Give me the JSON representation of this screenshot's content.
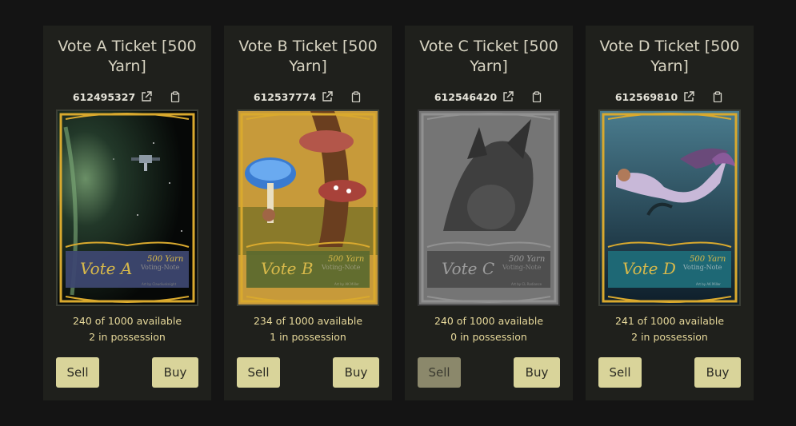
{
  "cards": [
    {
      "title": "Vote A Ticket [500 Yarn]",
      "id": "612495327",
      "availability": "240 of 1000 available",
      "possession": "2 in possession",
      "sell_label": "Sell",
      "buy_label": "Buy",
      "art": {
        "vote_text": "Vote A",
        "badge_text": "500 Yarn",
        "badge_sub": "Voting-Note",
        "panel_color": "#3d4770",
        "greyed": false,
        "credit": "Art by Claudiusknight"
      }
    },
    {
      "title": "Vote B Ticket [500 Yarn]",
      "id": "612537774",
      "availability": "234 of 1000 available",
      "possession": "1 in possession",
      "sell_label": "Sell",
      "buy_label": "Buy",
      "art": {
        "vote_text": "Vote B",
        "badge_text": "500 Yarn",
        "badge_sub": "Voting-Note",
        "panel_color": "#5d6a2e",
        "greyed": false,
        "credit": "Art by AK Miller"
      }
    },
    {
      "title": "Vote C Ticket [500 Yarn]",
      "id": "612546420",
      "availability": "240 of 1000 available",
      "possession": "0 in possession",
      "sell_label": "Sell",
      "buy_label": "Buy",
      "art": {
        "vote_text": "Vote C",
        "badge_text": "500 Yarn",
        "badge_sub": "Voting-Note",
        "panel_color": "#5a5a5a",
        "greyed": true,
        "credit": "Art by CL Radiance"
      }
    },
    {
      "title": "Vote D Ticket [500 Yarn]",
      "id": "612569810",
      "availability": "241 of 1000 available",
      "possession": "2 in possession",
      "sell_label": "Sell",
      "buy_label": "Buy",
      "art": {
        "vote_text": "Vote D",
        "badge_text": "500 Yarn",
        "badge_sub": "Voting-Note",
        "panel_color": "#1f6b78",
        "greyed": false,
        "credit": "Art by AK Miller"
      }
    }
  ],
  "icons": {
    "external": "external-link-icon",
    "copy": "clipboard-icon"
  }
}
